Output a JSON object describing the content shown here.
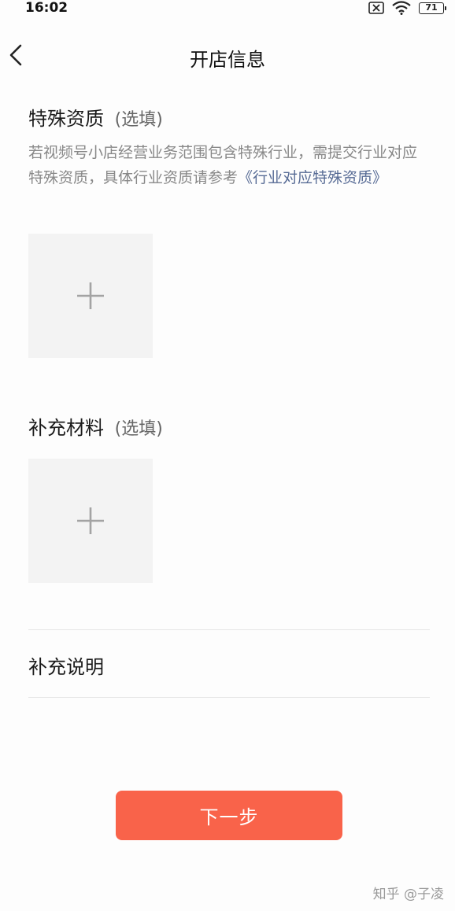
{
  "status_bar": {
    "time": "16:02",
    "battery": "71"
  },
  "header": {
    "title": "开店信息"
  },
  "special_qualification": {
    "title": "特殊资质",
    "optional": "(选填)",
    "description": "若视频号小店经营业务范围包含特殊行业，需提交行业对应特殊资质，具体行业资质请参考",
    "link": "《行业对应特殊资质》"
  },
  "supplementary_material": {
    "title": "补充材料",
    "optional": "(选填)"
  },
  "supplementary_note": {
    "label": "补充说明"
  },
  "footer": {
    "next_label": "下一步"
  },
  "watermark": "知乎 @子凌",
  "colors": {
    "accent": "#f9634a",
    "link": "#576b95",
    "upload_bg": "#f3f3f3"
  }
}
